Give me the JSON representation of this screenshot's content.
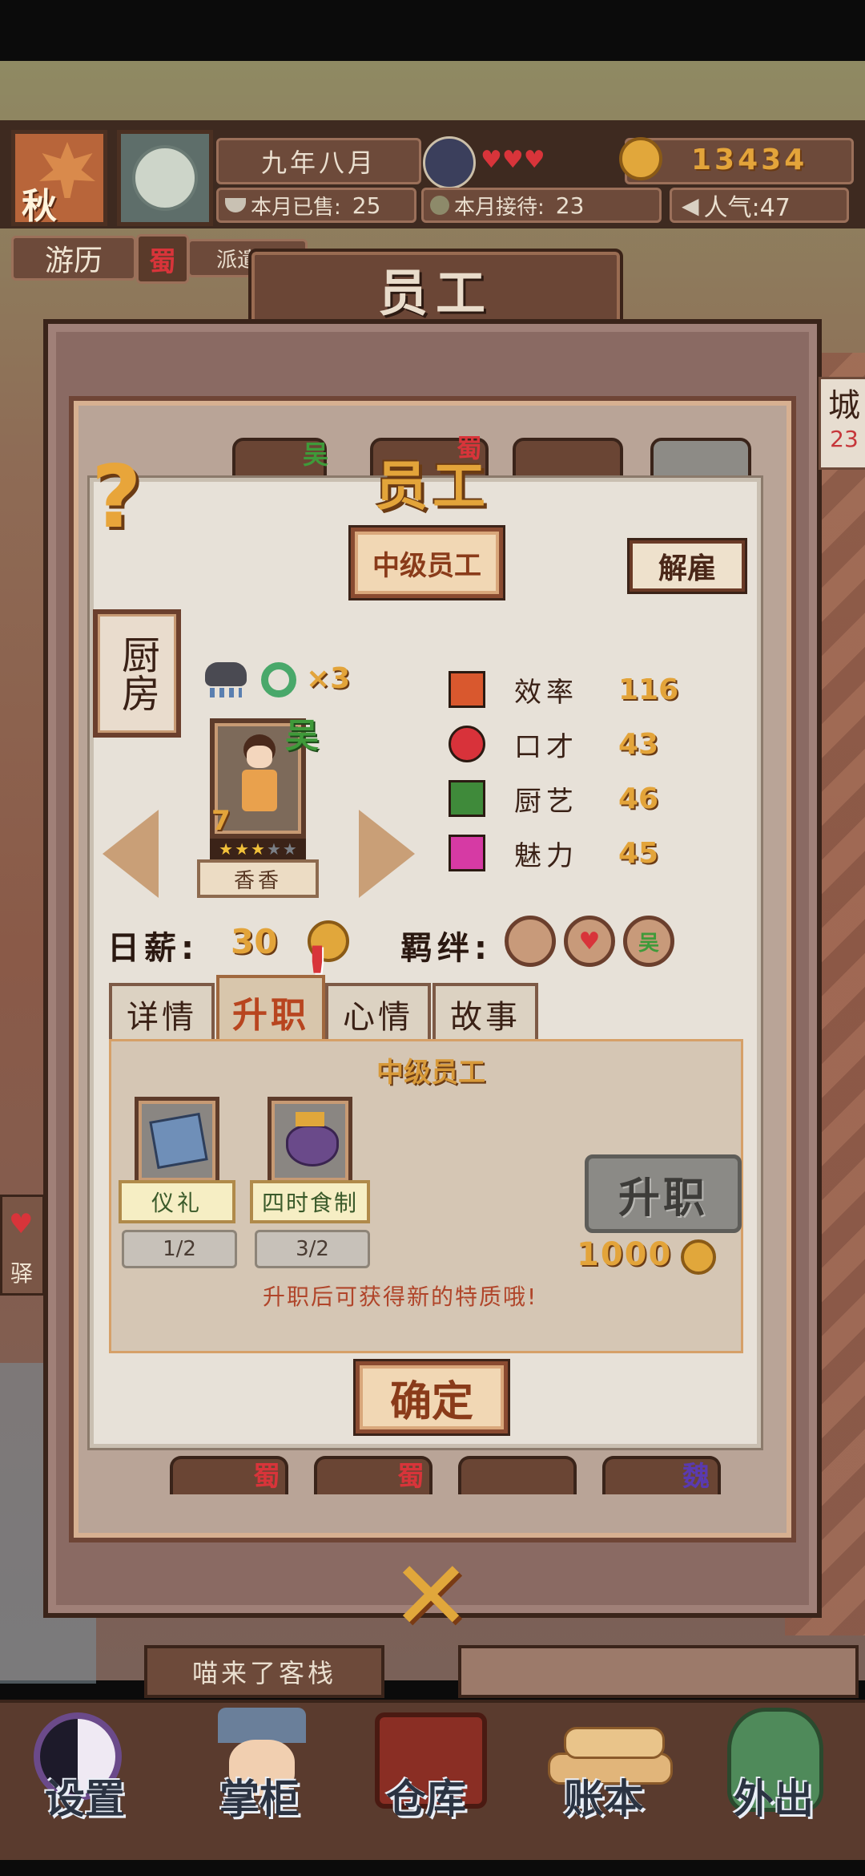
{
  "hud": {
    "season": "秋",
    "date": "九年八月",
    "coins": "13434",
    "sold_label": "本月已售:",
    "sold_value": "25",
    "served_label": "本月接待:",
    "served_value": "23",
    "popularity": "人气:47",
    "travel_label": "游历",
    "travel_region": "蜀",
    "travel_status": "派遣中"
  },
  "window": {
    "banner_title": "员工",
    "dialog_title": "员工",
    "rank_label": "中级员工",
    "dismiss_label": "解雇",
    "department": "厨房",
    "weather_multiplier": "×3",
    "region_tag": "吴",
    "level": "7",
    "stars_filled": 3,
    "stars_total": 5,
    "name": "香香",
    "wage_label": "日薪:",
    "wage_value": "30",
    "bond_label": "羁绊:",
    "stats": [
      {
        "label": "效率",
        "value": "116",
        "icon": "efficiency-icon",
        "color": "#d9582e"
      },
      {
        "label": "口才",
        "value": "43",
        "icon": "eloquence-icon",
        "color": "#d8323a"
      },
      {
        "label": "厨艺",
        "value": "46",
        "icon": "cooking-icon",
        "color": "#3f8a3a"
      },
      {
        "label": "魅力",
        "value": "45",
        "icon": "charm-icon",
        "color": "#d63aa4"
      }
    ],
    "tabs": [
      "详情",
      "升职",
      "心情",
      "故事"
    ],
    "active_tab": "升职",
    "promotion": {
      "title": "中级员工",
      "requirements": [
        {
          "label": "仪礼",
          "progress": "1/2",
          "icon": "etiquette-book-icon"
        },
        {
          "label": "四时食制",
          "progress": "3/2",
          "icon": "food-pouch-icon"
        }
      ],
      "promote_label": "升职",
      "cost": "1000",
      "hint": "升职后可获得新的特质哦!"
    },
    "confirm_label": "确定",
    "bottom_row_tags": [
      "蜀",
      "蜀",
      "",
      "魏"
    ],
    "top_row_tags": [
      "吴",
      "蜀",
      "",
      ""
    ]
  },
  "side": {
    "right_char": "城",
    "right_sub": "23",
    "left_char": "驿"
  },
  "bottom": {
    "inn_name": "喵来了客栈",
    "nav": [
      {
        "label": "设置",
        "icon": "yin-yang-settings-icon"
      },
      {
        "label": "掌柜",
        "icon": "shopkeeper-icon"
      },
      {
        "label": "仓库",
        "icon": "warehouse-chest-icon"
      },
      {
        "label": "账本",
        "icon": "ledger-scrolls-icon"
      },
      {
        "label": "外出",
        "icon": "outing-icon"
      }
    ]
  },
  "colors": {
    "wood": "#6e4a35",
    "panel": "#e7e1d8",
    "gold": "#e3a43a",
    "accent": "#8a3b1a"
  }
}
